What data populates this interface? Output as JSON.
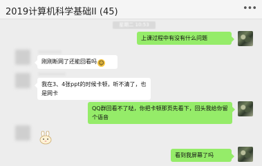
{
  "header": {
    "title": "2019计算机科学基础II (45)",
    "more_icon": "more-dots-icon"
  },
  "time_divider": "星期二 10:53",
  "messages": [
    {
      "side": "right",
      "text": "上课过程中有没有什么问题"
    },
    {
      "side": "left",
      "text": "刚刚断网了还能回看吗"
    },
    {
      "side": "left",
      "text": "我在3、4张ppt的时候卡顿，听不清了，也是网卡"
    },
    {
      "side": "right",
      "text": "QQ群回看不了哒，你把卡顿那页先看下，回头我给你留个语音"
    },
    {
      "side": "left",
      "sticker": "bunny-sticker-icon"
    },
    {
      "side": "right",
      "text": "看到我屏幕了吗"
    }
  ],
  "colors": {
    "self_bubble": "#95ec69",
    "other_bubble": "#ffffff",
    "background": "#ededed"
  }
}
